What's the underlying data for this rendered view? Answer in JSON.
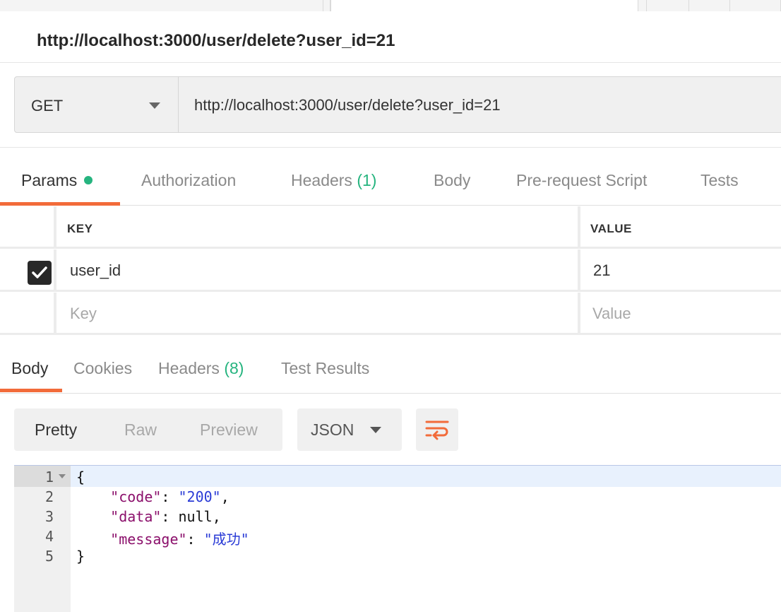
{
  "request": {
    "title": "http://localhost:3000/user/delete?user_id=21",
    "method": "GET",
    "url": "http://localhost:3000/user/delete?user_id=21"
  },
  "request_tabs": [
    {
      "label": "Params"
    },
    {
      "label": "Authorization"
    },
    {
      "label": "Headers",
      "count": "(1)"
    },
    {
      "label": "Body"
    },
    {
      "label": "Pre-request Script"
    },
    {
      "label": "Tests"
    }
  ],
  "params": {
    "headers": {
      "key": "KEY",
      "value": "VALUE"
    },
    "rows": [
      {
        "checked": true,
        "key": "user_id",
        "value": "21"
      }
    ],
    "placeholder": {
      "key": "Key",
      "value": "Value"
    }
  },
  "response_tabs": [
    {
      "label": "Body"
    },
    {
      "label": "Cookies"
    },
    {
      "label": "Headers",
      "count": "(8)"
    },
    {
      "label": "Test Results"
    }
  ],
  "response_view": {
    "modes": [
      "Pretty",
      "Raw",
      "Preview"
    ],
    "active_mode": "Pretty",
    "format": "JSON"
  },
  "response_body": {
    "line_numbers": [
      "1",
      "2",
      "3",
      "4",
      "5"
    ],
    "open_brace": "{",
    "close_brace": "}",
    "code_key": "\"code\"",
    "code_value": "\"200\"",
    "data_key": "\"data\"",
    "data_value": "null",
    "message_key": "\"message\"",
    "message_value": "\"成功\""
  },
  "colors": {
    "accent": "#f26b3a",
    "success": "#26b47f",
    "json_key": "#8b0f6b",
    "json_string": "#2a3bd6"
  }
}
